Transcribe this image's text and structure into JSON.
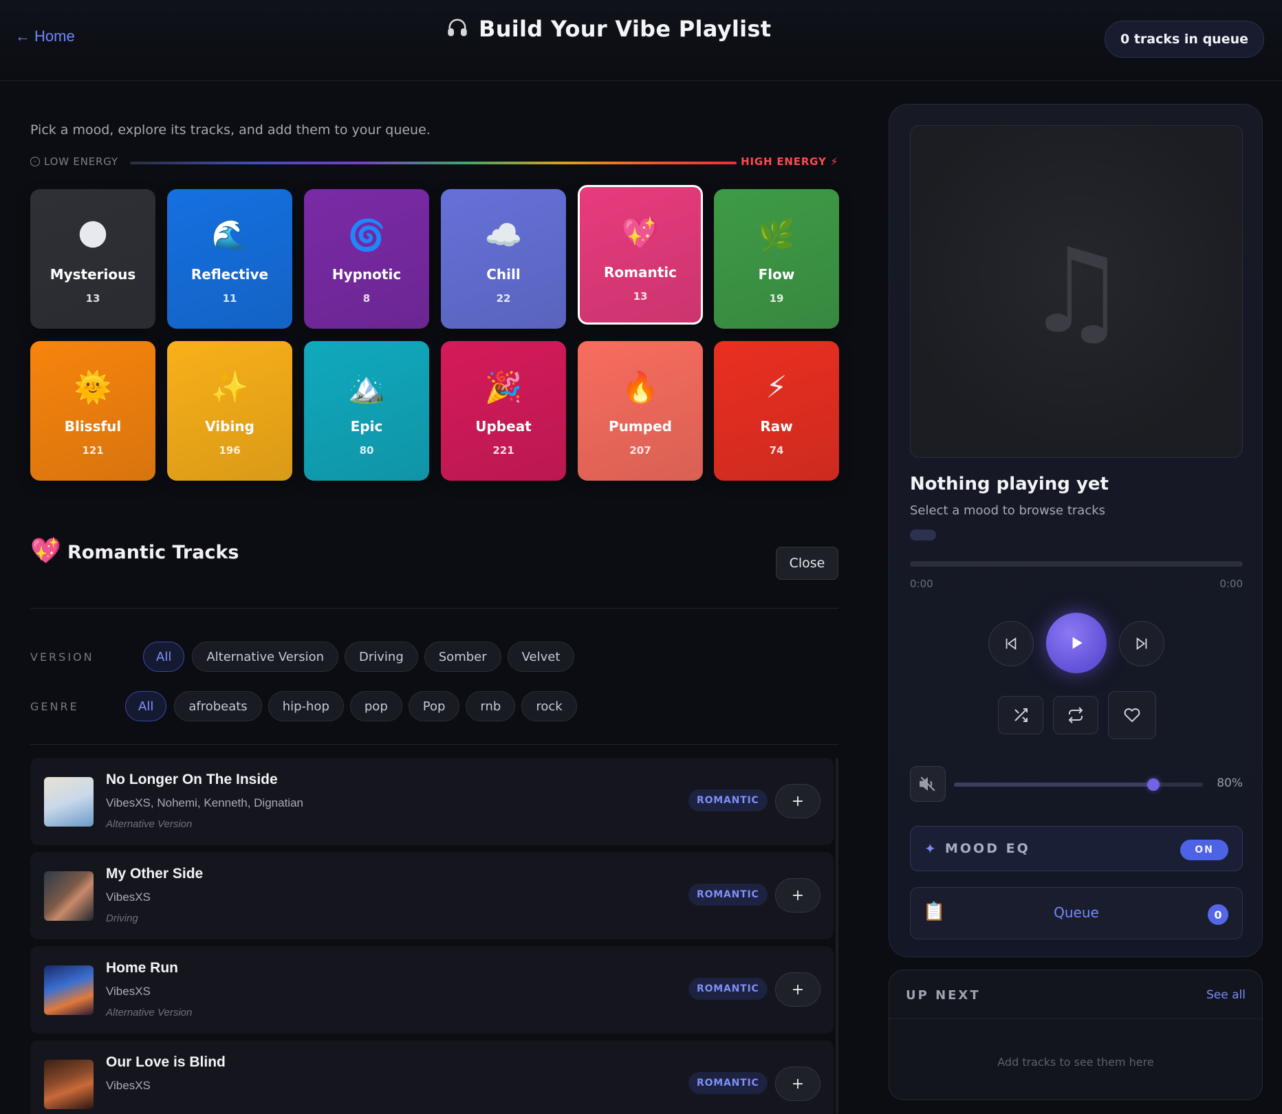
{
  "header": {
    "home_label": "Home",
    "title": "Build Your Vibe Playlist",
    "queue_status": "0 tracks in queue"
  },
  "intro": {
    "subtitle": "Pick a mood, explore its tracks, and add them to your queue.",
    "low_energy": "LOW ENERGY",
    "high_energy": "HIGH ENERGY"
  },
  "moods": [
    {
      "name": "Mysterious",
      "count": "13",
      "emoji": "🌑",
      "color": "#2e3036"
    },
    {
      "name": "Reflective",
      "count": "11",
      "emoji": "🌊",
      "color": "#1570e0"
    },
    {
      "name": "Hypnotic",
      "count": "8",
      "emoji": "🌀",
      "color": "#7a2aa6"
    },
    {
      "name": "Chill",
      "count": "22",
      "emoji": "☁️",
      "color": "#6571d8"
    },
    {
      "name": "Romantic",
      "count": "13",
      "emoji": "💖",
      "color": "#e83b7d",
      "selected": true
    },
    {
      "name": "Flow",
      "count": "19",
      "emoji": "🌿",
      "color": "#3e9b46"
    },
    {
      "name": "Blissful",
      "count": "121",
      "emoji": "🌞",
      "color": "#f7840d"
    },
    {
      "name": "Vibing",
      "count": "196",
      "emoji": "✨",
      "color": "#f9b019"
    },
    {
      "name": "Epic",
      "count": "80",
      "emoji": "🏔️",
      "color": "#10a9bd"
    },
    {
      "name": "Upbeat",
      "count": "221",
      "emoji": "🎉",
      "color": "#d51a5a"
    },
    {
      "name": "Pumped",
      "count": "207",
      "emoji": "🔥",
      "color": "#f86d5e"
    },
    {
      "name": "Raw",
      "count": "74",
      "emoji": "⚡",
      "color": "#ea2f21"
    }
  ],
  "section": {
    "emoji": "💖",
    "title": "Romantic Tracks",
    "close_label": "Close"
  },
  "filters": {
    "version_label": "VERSION",
    "version_options": [
      "All",
      "Alternative Version",
      "Driving",
      "Somber",
      "Velvet"
    ],
    "genre_label": "GENRE",
    "genre_options": [
      "All",
      "afrobeats",
      "hip-hop",
      "pop",
      "Pop",
      "rnb",
      "rock"
    ]
  },
  "tracks": [
    {
      "title": "No Longer On The Inside",
      "artists": "VibesXS, Nohemi, Kenneth, Dignatian",
      "version": "Alternative Version",
      "mood": "ROMANTIC",
      "add": "+"
    },
    {
      "title": "My Other Side",
      "artists": "VibesXS",
      "version": "Driving",
      "mood": "ROMANTIC",
      "add": "+"
    },
    {
      "title": "Home Run",
      "artists": "VibesXS",
      "version": "Alternative Version",
      "mood": "ROMANTIC",
      "add": "+"
    },
    {
      "title": "Our Love is Blind",
      "artists": "VibesXS",
      "version": "",
      "mood": "ROMANTIC",
      "add": "+"
    }
  ],
  "player": {
    "now_title": "Nothing playing yet",
    "now_sub": "Select a mood to browse tracks",
    "time_current": "0:00",
    "time_total": "0:00",
    "volume_label": "80%",
    "volume_level": 0.8,
    "mood_eq_label": "MOOD EQ",
    "mood_eq_state": "ON",
    "queue_label": "Queue",
    "queue_count": "0"
  },
  "upnext": {
    "title": "UP NEXT",
    "see_all": "See all",
    "empty": "Add tracks to see them here"
  }
}
